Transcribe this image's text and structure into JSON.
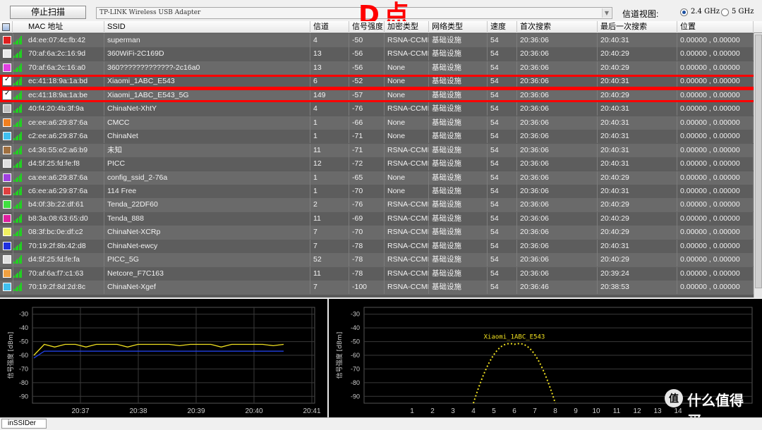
{
  "toolbar": {
    "stop_scan_label": "停止扫描",
    "adapter_value": "TP-LINK Wireless USB Adapter",
    "channel_view_label": "信道视图:",
    "band_24_label": "2.4 GHz",
    "band_5_label": "5 GHz",
    "band_selected": "2.4 GHz"
  },
  "annotation": {
    "text": "D点"
  },
  "table": {
    "headers": [
      "MAC 地址",
      "SSID",
      "信道",
      "信号强度",
      "加密类型",
      "网络类型",
      "速度",
      "首次搜索",
      "最后一次搜索",
      "位置"
    ],
    "rows": [
      {
        "color": "#e02020",
        "checked": false,
        "mac": "d4:ee:07:4c:fb:42",
        "ssid": "superman",
        "channel": "4",
        "rssi": "-50",
        "security": "RSNA-CCMP",
        "network": "基础设施",
        "speed": "54",
        "first_seen": "20:36:06",
        "last_seen": "20:40:31",
        "location": "0.00000 , 0.00000"
      },
      {
        "color": "#e8e8e8",
        "checked": false,
        "mac": "70:af:6a:2c:16:9d",
        "ssid": "360WiFi-2C169D",
        "channel": "13",
        "rssi": "-56",
        "security": "RSNA-CCMP",
        "network": "基础设施",
        "speed": "54",
        "first_seen": "20:36:06",
        "last_seen": "20:40:29",
        "location": "0.00000 , 0.00000"
      },
      {
        "color": "#e040e0",
        "checked": false,
        "mac": "70:af:6a:2c:16:a0",
        "ssid": "360?????????????-2c16a0",
        "channel": "13",
        "rssi": "-56",
        "security": "None",
        "network": "基础设施",
        "speed": "54",
        "first_seen": "20:36:06",
        "last_seen": "20:40:29",
        "location": "0.00000 , 0.00000"
      },
      {
        "color": "#f0e020",
        "checked": true,
        "mac": "ec:41:18:9a:1a:bd",
        "ssid": "Xiaomi_1ABC_E543",
        "channel": "6",
        "rssi": "-52",
        "security": "None",
        "network": "基础设施",
        "speed": "54",
        "first_seen": "20:36:06",
        "last_seen": "20:40:31",
        "location": "0.00000 , 0.00000"
      },
      {
        "color": "#2040e0",
        "checked": true,
        "mac": "ec:41:18:9a:1a:be",
        "ssid": "Xiaomi_1ABC_E543_5G",
        "channel": "149",
        "rssi": "-57",
        "security": "None",
        "network": "基础设施",
        "speed": "54",
        "first_seen": "20:36:06",
        "last_seen": "20:40:29",
        "location": "0.00000 , 0.00000"
      },
      {
        "color": "#c0c0c0",
        "checked": false,
        "mac": "40:f4:20:4b:3f:9a",
        "ssid": "ChinaNet-XhtY",
        "channel": "4",
        "rssi": "-76",
        "security": "RSNA-CCMP",
        "network": "基础设施",
        "speed": "54",
        "first_seen": "20:36:06",
        "last_seen": "20:40:31",
        "location": "0.00000 , 0.00000"
      },
      {
        "color": "#f08020",
        "checked": false,
        "mac": "ce:ee:a6:29:87:6a",
        "ssid": "CMCC",
        "channel": "1",
        "rssi": "-66",
        "security": "None",
        "network": "基础设施",
        "speed": "54",
        "first_seen": "20:36:06",
        "last_seen": "20:40:31",
        "location": "0.00000 , 0.00000"
      },
      {
        "color": "#40c0f0",
        "checked": false,
        "mac": "c2:ee:a6:29:87:6a",
        "ssid": "ChinaNet",
        "channel": "1",
        "rssi": "-71",
        "security": "None",
        "network": "基础设施",
        "speed": "54",
        "first_seen": "20:36:06",
        "last_seen": "20:40:31",
        "location": "0.00000 , 0.00000"
      },
      {
        "color": "#a07040",
        "checked": false,
        "mac": "c4:36:55:e2:a6:b9",
        "ssid": "未知",
        "channel": "11",
        "rssi": "-71",
        "security": "RSNA-CCMP",
        "network": "基础设施",
        "speed": "54",
        "first_seen": "20:36:06",
        "last_seen": "20:40:31",
        "location": "0.00000 , 0.00000"
      },
      {
        "color": "#e0e0e0",
        "checked": false,
        "mac": "d4:5f:25:fd:fe:f8",
        "ssid": "PICC",
        "channel": "12",
        "rssi": "-72",
        "security": "RSNA-CCMP",
        "network": "基础设施",
        "speed": "54",
        "first_seen": "20:36:06",
        "last_seen": "20:40:31",
        "location": "0.00000 , 0.00000"
      },
      {
        "color": "#a040e0",
        "checked": false,
        "mac": "ca:ee:a6:29:87:6a",
        "ssid": "config_ssid_2-76a",
        "channel": "1",
        "rssi": "-65",
        "security": "None",
        "network": "基础设施",
        "speed": "54",
        "first_seen": "20:36:06",
        "last_seen": "20:40:29",
        "location": "0.00000 , 0.00000"
      },
      {
        "color": "#e04040",
        "checked": false,
        "mac": "c6:ee:a6:29:87:6a",
        "ssid": "114 Free",
        "channel": "1",
        "rssi": "-70",
        "security": "None",
        "network": "基础设施",
        "speed": "54",
        "first_seen": "20:36:06",
        "last_seen": "20:40:31",
        "location": "0.00000 , 0.00000"
      },
      {
        "color": "#40e040",
        "checked": false,
        "mac": "b4:0f:3b:22:df:61",
        "ssid": "Tenda_22DF60",
        "channel": "2",
        "rssi": "-76",
        "security": "RSNA-CCMP",
        "network": "基础设施",
        "speed": "54",
        "first_seen": "20:36:06",
        "last_seen": "20:40:29",
        "location": "0.00000 , 0.00000"
      },
      {
        "color": "#e020a0",
        "checked": false,
        "mac": "b8:3a:08:63:65:d0",
        "ssid": "Tenda_888",
        "channel": "11",
        "rssi": "-69",
        "security": "RSNA-CCMP",
        "network": "基础设施",
        "speed": "54",
        "first_seen": "20:36:06",
        "last_seen": "20:40:29",
        "location": "0.00000 , 0.00000"
      },
      {
        "color": "#f0f060",
        "checked": false,
        "mac": "08:3f:bc:0e:df:c2",
        "ssid": "ChinaNet-XCRp",
        "channel": "7",
        "rssi": "-70",
        "security": "RSNA-CCMP",
        "network": "基础设施",
        "speed": "54",
        "first_seen": "20:36:06",
        "last_seen": "20:40:29",
        "location": "0.00000 , 0.00000"
      },
      {
        "color": "#2030e0",
        "checked": false,
        "mac": "70:19:2f:8b:42:d8",
        "ssid": "ChinaNet-ewcy",
        "channel": "7",
        "rssi": "-78",
        "security": "RSNA-CCMP",
        "network": "基础设施",
        "speed": "54",
        "first_seen": "20:36:06",
        "last_seen": "20:40:31",
        "location": "0.00000 , 0.00000"
      },
      {
        "color": "#e0e0e0",
        "checked": false,
        "mac": "d4:5f:25:fd:fe:fa",
        "ssid": "PICC_5G",
        "channel": "52",
        "rssi": "-78",
        "security": "RSNA-CCMP",
        "network": "基础设施",
        "speed": "54",
        "first_seen": "20:36:06",
        "last_seen": "20:40:29",
        "location": "0.00000 , 0.00000"
      },
      {
        "color": "#f0a040",
        "checked": false,
        "mac": "70:af:6a:f7:c1:63",
        "ssid": "Netcore_F7C163",
        "channel": "11",
        "rssi": "-78",
        "security": "RSNA-CCMP",
        "network": "基础设施",
        "speed": "54",
        "first_seen": "20:36:06",
        "last_seen": "20:39:24",
        "location": "0.00000 , 0.00000"
      },
      {
        "color": "#40c0f0",
        "checked": false,
        "mac": "70:19:2f:8d:2d:8c",
        "ssid": "ChinaNet-Xgef",
        "channel": "7",
        "rssi": "-100",
        "security": "RSNA-CCMP",
        "network": "基础设施",
        "speed": "54",
        "first_seen": "20:36:46",
        "last_seen": "20:38:53",
        "location": "0.00000 , 0.00000"
      }
    ]
  },
  "time_graph": {
    "ylabel": "信号强度 [dBm]",
    "y_ticks": [
      "-30",
      "-40",
      "-50",
      "-60",
      "-70",
      "-80",
      "-90"
    ],
    "x_ticks": [
      "20:37",
      "20:38",
      "20:39",
      "20:40",
      "20:41"
    ]
  },
  "channel_graph": {
    "ylabel": "信号强度 [dBm]",
    "y_ticks": [
      "-30",
      "-40",
      "-50",
      "-60",
      "-70",
      "-80",
      "-90"
    ],
    "x_ticks": [
      "1",
      "2",
      "3",
      "4",
      "5",
      "6",
      "7",
      "8",
      "9",
      "10",
      "11",
      "12",
      "13",
      "14"
    ],
    "network_label": "Xiaomi_1ABC_E543"
  },
  "chart_data": [
    {
      "type": "line",
      "xlabel": "",
      "ylabel": "信号强度 [dBm]",
      "ylim": [
        -95,
        -25
      ],
      "x_ticks": [
        "20:37",
        "20:38",
        "20:39",
        "20:40",
        "20:41"
      ],
      "series": [
        {
          "name": "Xiaomi_1ABC_E543",
          "color": "#f0e020",
          "values": [
            -60,
            -52,
            -54,
            -52,
            -52,
            -54,
            -52,
            -52,
            -52,
            -54,
            -52,
            -52,
            -52,
            -52,
            -53,
            -52,
            -52,
            -52,
            -54,
            -52,
            -52,
            -52,
            -52,
            -53,
            -52
          ]
        },
        {
          "name": "Xiaomi_1ABC_E543_5G",
          "color": "#2040e0",
          "values": [
            -62,
            -57,
            -57,
            -57,
            -57,
            -57,
            -57,
            -57,
            -57,
            -57,
            -57,
            -57,
            -57,
            -57,
            -57,
            -57,
            -57,
            -57,
            -57,
            -57,
            -57,
            -57,
            -57,
            -57,
            -57
          ]
        }
      ]
    },
    {
      "type": "area",
      "xlabel": "",
      "ylabel": "信号强度 [dBm]",
      "ylim": [
        -95,
        -25
      ],
      "x": [
        1,
        2,
        3,
        4,
        5,
        6,
        7,
        8,
        9,
        10,
        11,
        12,
        13,
        14
      ],
      "series": [
        {
          "name": "Xiaomi_1ABC_E543",
          "color": "#f0e020",
          "center_channel": 6,
          "peak": -52,
          "span": [
            4,
            8
          ]
        }
      ]
    }
  ],
  "status": {
    "tab_label": "inSSIDer"
  },
  "watermark": {
    "logo": "值",
    "text": "什么值得买"
  },
  "colors": {
    "highlight": "#ff0000",
    "signal": "#22d022"
  }
}
